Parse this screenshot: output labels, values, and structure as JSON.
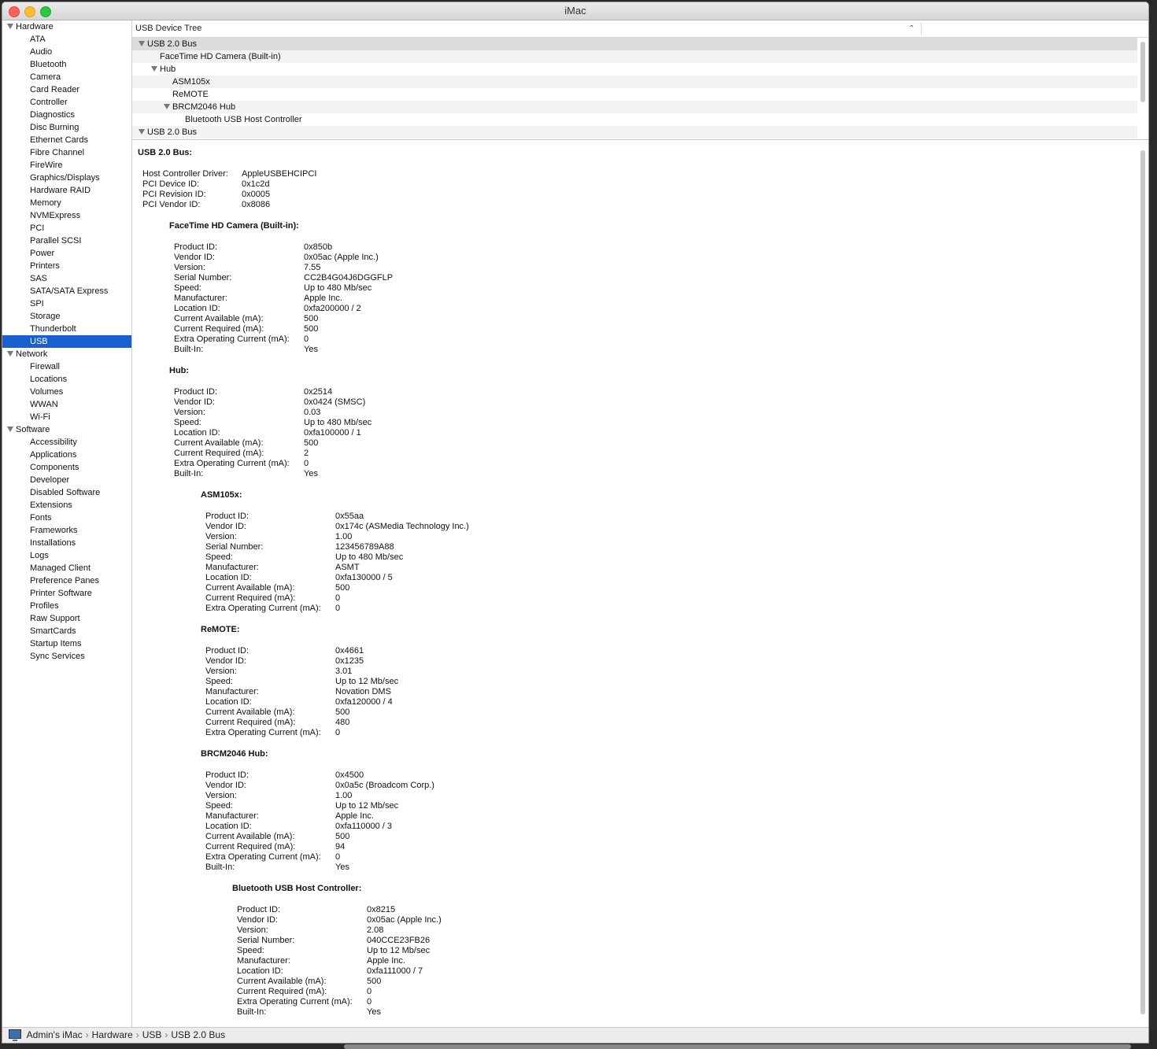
{
  "window": {
    "title": "iMac"
  },
  "sidebar": {
    "groups": [
      {
        "label": "Hardware",
        "items": [
          "ATA",
          "Audio",
          "Bluetooth",
          "Camera",
          "Card Reader",
          "Controller",
          "Diagnostics",
          "Disc Burning",
          "Ethernet Cards",
          "Fibre Channel",
          "FireWire",
          "Graphics/Displays",
          "Hardware RAID",
          "Memory",
          "NVMExpress",
          "PCI",
          "Parallel SCSI",
          "Power",
          "Printers",
          "SAS",
          "SATA/SATA Express",
          "SPI",
          "Storage",
          "Thunderbolt",
          "USB"
        ]
      },
      {
        "label": "Network",
        "items": [
          "Firewall",
          "Locations",
          "Volumes",
          "WWAN",
          "Wi-Fi"
        ]
      },
      {
        "label": "Software",
        "items": [
          "Accessibility",
          "Applications",
          "Components",
          "Developer",
          "Disabled Software",
          "Extensions",
          "Fonts",
          "Frameworks",
          "Installations",
          "Logs",
          "Managed Client",
          "Preference Panes",
          "Printer Software",
          "Profiles",
          "Raw Support",
          "SmartCards",
          "Startup Items",
          "Sync Services"
        ]
      }
    ],
    "selected": "USB"
  },
  "tree": {
    "header": "USB Device Tree",
    "rows": [
      {
        "label": "USB 2.0 Bus",
        "level": 0,
        "expanded": true
      },
      {
        "label": "FaceTime HD Camera (Built-in)",
        "level": 1,
        "expanded": false
      },
      {
        "label": "Hub",
        "level": 1,
        "expanded": true
      },
      {
        "label": "ASM105x",
        "level": 2,
        "expanded": false
      },
      {
        "label": "ReMOTE",
        "level": 2,
        "expanded": false
      },
      {
        "label": "BRCM2046 Hub",
        "level": 2,
        "expanded": true
      },
      {
        "label": "Bluetooth USB Host Controller",
        "level": 3,
        "expanded": false
      },
      {
        "label": "USB 2.0 Bus",
        "level": 0,
        "expanded": true
      }
    ]
  },
  "detail": {
    "title": "USB 2.0 Bus:",
    "bus_props": [
      [
        "Host Controller Driver:",
        "AppleUSBEHCIPCI"
      ],
      [
        "PCI Device ID:",
        "0x1c2d"
      ],
      [
        "PCI Revision ID:",
        "0x0005"
      ],
      [
        "PCI Vendor ID:",
        "0x8086"
      ]
    ],
    "devices": [
      {
        "title": "FaceTime HD Camera (Built-in):",
        "level": 1,
        "props": [
          [
            "Product ID:",
            "0x850b"
          ],
          [
            "Vendor ID:",
            "0x05ac (Apple Inc.)"
          ],
          [
            "Version:",
            "7.55"
          ],
          [
            "Serial Number:",
            "CC2B4G04J6DGGFLP"
          ],
          [
            "Speed:",
            "Up to 480 Mb/sec"
          ],
          [
            "Manufacturer:",
            "Apple Inc."
          ],
          [
            "Location ID:",
            "0xfa200000 / 2"
          ],
          [
            "Current Available (mA):",
            "500"
          ],
          [
            "Current Required (mA):",
            "500"
          ],
          [
            "Extra Operating Current (mA):",
            "0"
          ],
          [
            "Built-In:",
            "Yes"
          ]
        ]
      },
      {
        "title": "Hub:",
        "level": 1,
        "props": [
          [
            "Product ID:",
            "0x2514"
          ],
          [
            "Vendor ID:",
            "0x0424  (SMSC)"
          ],
          [
            "Version:",
            "0.03"
          ],
          [
            "Speed:",
            "Up to 480 Mb/sec"
          ],
          [
            "Location ID:",
            "0xfa100000 / 1"
          ],
          [
            "Current Available (mA):",
            "500"
          ],
          [
            "Current Required (mA):",
            "2"
          ],
          [
            "Extra Operating Current (mA):",
            "0"
          ],
          [
            "Built-In:",
            "Yes"
          ]
        ]
      },
      {
        "title": "ASM105x:",
        "level": 2,
        "props": [
          [
            "Product ID:",
            "0x55aa"
          ],
          [
            "Vendor ID:",
            "0x174c  (ASMedia Technology Inc.)"
          ],
          [
            "Version:",
            "1.00"
          ],
          [
            "Serial Number:",
            "123456789A88"
          ],
          [
            "Speed:",
            "Up to 480 Mb/sec"
          ],
          [
            "Manufacturer:",
            "ASMT"
          ],
          [
            "Location ID:",
            "0xfa130000 / 5"
          ],
          [
            "Current Available (mA):",
            "500"
          ],
          [
            "Current Required (mA):",
            "0"
          ],
          [
            "Extra Operating Current (mA):",
            "0"
          ]
        ]
      },
      {
        "title": "ReMOTE:",
        "level": 2,
        "props": [
          [
            "Product ID:",
            "0x4661"
          ],
          [
            "Vendor ID:",
            "0x1235"
          ],
          [
            "Version:",
            "3.01"
          ],
          [
            "Speed:",
            "Up to 12 Mb/sec"
          ],
          [
            "Manufacturer:",
            "Novation DMS"
          ],
          [
            "Location ID:",
            "0xfa120000 / 4"
          ],
          [
            "Current Available (mA):",
            "500"
          ],
          [
            "Current Required (mA):",
            "480"
          ],
          [
            "Extra Operating Current (mA):",
            "0"
          ]
        ]
      },
      {
        "title": "BRCM2046 Hub:",
        "level": 2,
        "props": [
          [
            "Product ID:",
            "0x4500"
          ],
          [
            "Vendor ID:",
            "0x0a5c  (Broadcom Corp.)"
          ],
          [
            "Version:",
            "1.00"
          ],
          [
            "Speed:",
            "Up to 12 Mb/sec"
          ],
          [
            "Manufacturer:",
            "Apple Inc."
          ],
          [
            "Location ID:",
            "0xfa110000 / 3"
          ],
          [
            "Current Available (mA):",
            "500"
          ],
          [
            "Current Required (mA):",
            "94"
          ],
          [
            "Extra Operating Current (mA):",
            "0"
          ],
          [
            "Built-In:",
            "Yes"
          ]
        ]
      },
      {
        "title": "Bluetooth USB Host Controller:",
        "level": 3,
        "props": [
          [
            "Product ID:",
            "0x8215"
          ],
          [
            "Vendor ID:",
            "0x05ac (Apple Inc.)"
          ],
          [
            "Version:",
            "2.08"
          ],
          [
            "Serial Number:",
            "040CCE23FB26"
          ],
          [
            "Speed:",
            "Up to 12 Mb/sec"
          ],
          [
            "Manufacturer:",
            "Apple Inc."
          ],
          [
            "Location ID:",
            "0xfa111000 / 7"
          ],
          [
            "Current Available (mA):",
            "500"
          ],
          [
            "Current Required (mA):",
            "0"
          ],
          [
            "Extra Operating Current (mA):",
            "0"
          ],
          [
            "Built-In:",
            "Yes"
          ]
        ]
      }
    ]
  },
  "breadcrumb": [
    "Admin's iMac",
    "Hardware",
    "USB",
    "USB 2.0 Bus"
  ]
}
